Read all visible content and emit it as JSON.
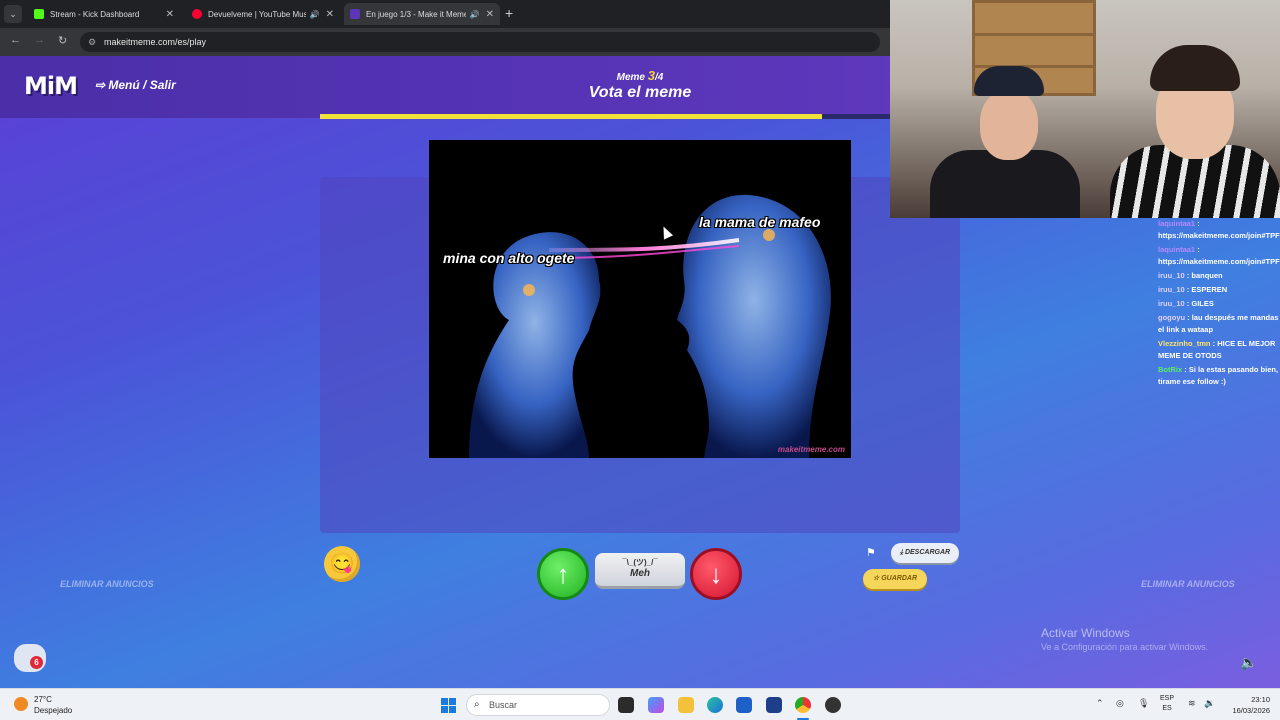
{
  "browser": {
    "tabs": [
      {
        "title": "Stream - Kick Dashboard",
        "favicon_color": "#53fc18",
        "active": false
      },
      {
        "title": "Devuelveme | YouTube Music",
        "favicon_color": "#ff0033",
        "active": false
      },
      {
        "title": "En juego 1/3 - Make it Meme",
        "favicon_color": "#5b36b9",
        "active": true
      }
    ],
    "new_tab": "+",
    "address": "makeitmeme.com/es/play"
  },
  "game": {
    "logo": "MiM",
    "menu_exit": "Menú / Salir",
    "meme_label": "Meme",
    "meme_current": "3",
    "meme_total": "/4",
    "title": "Vota el meme",
    "progress_fraction": 0.88,
    "meme": {
      "caption_left": "mina con alto ogete",
      "caption_right": "la mama de mafeo",
      "watermark": "makeitmeme.com"
    },
    "vote": {
      "meh_shrug": "¯\\_(ツ)_/¯",
      "meh_label": "Meh"
    },
    "download_label": "DESCARGAR",
    "save_label": "GUARDAR",
    "remove_ads_left": "ELIMINAR ANUNCIOS",
    "remove_ads_right": "ELIMINAR ANUNCIOS",
    "chat_badge": "6"
  },
  "chat": [
    {
      "user": "laquintaa1",
      "text": ": https://makeitmeme.com/join#TPFKK",
      "color": "purple"
    },
    {
      "user": "laquintaa1",
      "text": ": https://makeitmeme.com/join#TPFKK",
      "color": "purple"
    },
    {
      "user": "iruu_10",
      "text": ": banquen",
      "color": "default"
    },
    {
      "user": "iruu_10",
      "text": ": ESPEREN",
      "color": "default"
    },
    {
      "user": "iruu_10",
      "text": ": GILES",
      "color": "default"
    },
    {
      "user": "gogoyu",
      "text": ": lau después me mandas el link a wataap",
      "color": "default"
    },
    {
      "user": "Vlezzinho_tmn",
      "text": ": HICE EL MEJOR MEME DE OTODS",
      "color": "yellow"
    },
    {
      "user": "BotRix",
      "text": ": Si la estas pasando bien, tirame ese follow :)",
      "color": "green"
    }
  ],
  "windows": {
    "activate_title": "Activar Windows",
    "activate_sub": "Ve a Configuración para activar Windows.",
    "weather_temp": "27°C",
    "weather_desc": "Despejado",
    "search_placeholder": "Buscar",
    "lang_1": "ESP",
    "lang_2": "ES",
    "time": "23:10",
    "date": "16/03/2026"
  }
}
